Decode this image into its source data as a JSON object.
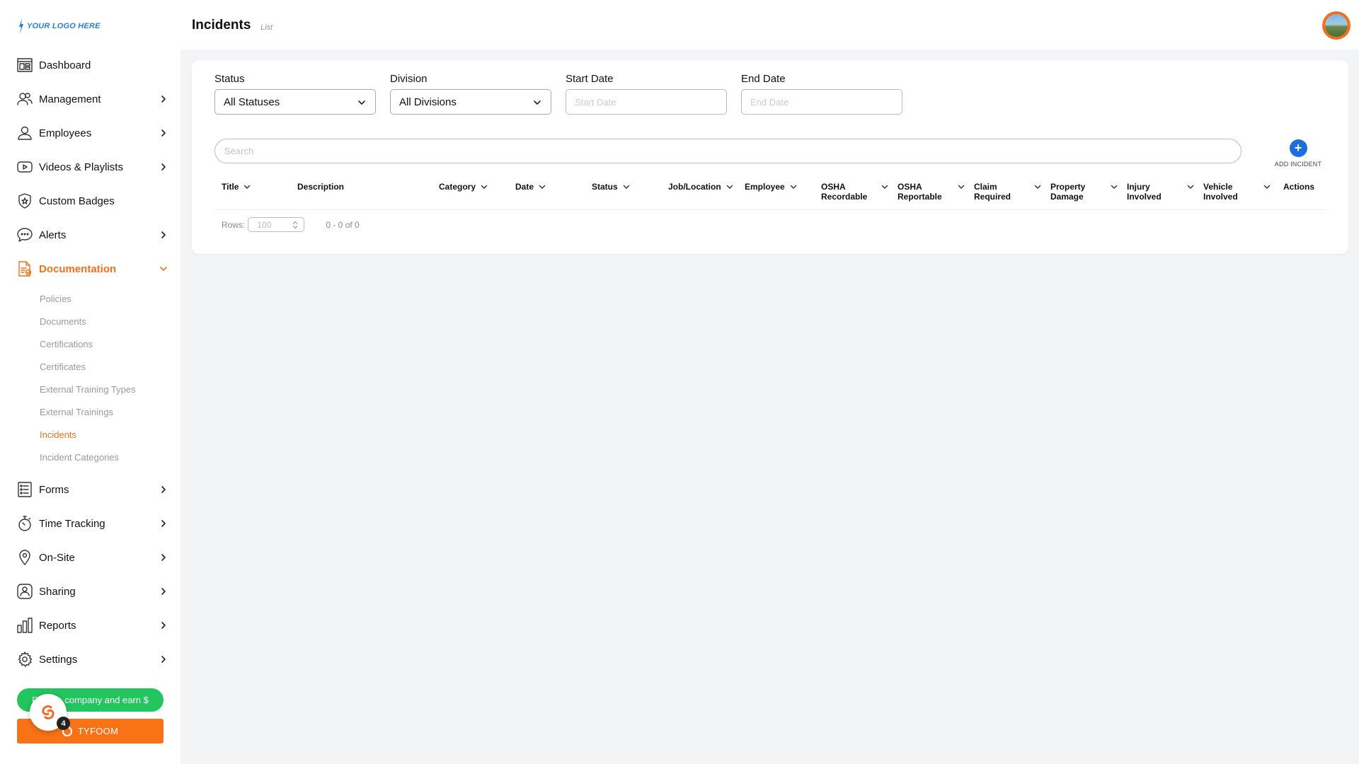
{
  "logo": {
    "text": "YOUR LOGO HERE"
  },
  "header": {
    "title": "Incidents",
    "subtitle": "List"
  },
  "sidebar": {
    "items": [
      {
        "id": "dashboard",
        "label": "Dashboard",
        "icon": "dashboard-icon",
        "chevron": false
      },
      {
        "id": "management",
        "label": "Management",
        "icon": "users-icon",
        "chevron": true
      },
      {
        "id": "employees",
        "label": "Employees",
        "icon": "user-icon",
        "chevron": true
      },
      {
        "id": "videos",
        "label": "Videos & Playlists",
        "icon": "play-icon",
        "chevron": true
      },
      {
        "id": "badges",
        "label": "Custom Badges",
        "icon": "badge-icon",
        "chevron": false
      },
      {
        "id": "alerts",
        "label": "Alerts",
        "icon": "chat-icon",
        "chevron": true
      },
      {
        "id": "documentation",
        "label": "Documentation",
        "icon": "document-icon",
        "chevron": true,
        "expanded": true
      },
      {
        "id": "forms",
        "label": "Forms",
        "icon": "form-icon",
        "chevron": true
      },
      {
        "id": "time-tracking",
        "label": "Time Tracking",
        "icon": "stopwatch-icon",
        "chevron": true
      },
      {
        "id": "on-site",
        "label": "On-Site",
        "icon": "location-icon",
        "chevron": true
      },
      {
        "id": "sharing",
        "label": "Sharing",
        "icon": "share-icon",
        "chevron": true
      },
      {
        "id": "reports",
        "label": "Reports",
        "icon": "bar-chart-icon",
        "chevron": true
      },
      {
        "id": "settings",
        "label": "Settings",
        "icon": "gear-icon",
        "chevron": true
      }
    ],
    "documentation_sub": [
      "Policies",
      "Documents",
      "Certifications",
      "Certificates",
      "External Training Types",
      "External Trainings",
      "Incidents",
      "Incident Categories"
    ],
    "active_sub": "Incidents",
    "refer_label": "Refer a company and earn $",
    "tyfoom_label": "TYFOOM",
    "notification_count": "4"
  },
  "filters": {
    "status": {
      "label": "Status",
      "value": "All Statuses"
    },
    "division": {
      "label": "Division",
      "value": "All Divisions"
    },
    "start_date": {
      "label": "Start Date",
      "placeholder": "Start Date"
    },
    "end_date": {
      "label": "End Date",
      "placeholder": "End Date"
    }
  },
  "search": {
    "placeholder": "Search"
  },
  "add_incident": {
    "label": "ADD INCIDENT"
  },
  "table": {
    "columns": [
      {
        "label": "Title",
        "sortable": true
      },
      {
        "label": "Description",
        "sortable": false
      },
      {
        "label": "Category",
        "sortable": true
      },
      {
        "label": "Date",
        "sortable": true
      },
      {
        "label": "Status",
        "sortable": true
      },
      {
        "label": "Job/Location",
        "sortable": true
      },
      {
        "label": "Employee",
        "sortable": true
      },
      {
        "label": "OSHA Recordable",
        "sortable": true
      },
      {
        "label": "OSHA Reportable",
        "sortable": true
      },
      {
        "label": "Claim Required",
        "sortable": true
      },
      {
        "label": "Property Damage",
        "sortable": true
      },
      {
        "label": "Injury Involved",
        "sortable": true
      },
      {
        "label": "Vehicle Involved",
        "sortable": true
      },
      {
        "label": "Actions",
        "sortable": false
      }
    ],
    "rows": []
  },
  "pagination": {
    "rows_label": "Rows:",
    "rows_value": "100",
    "range": "0 - 0 of 0"
  },
  "colors": {
    "accent": "#f07020",
    "primary": "#1d6fe0",
    "refer": "#22c55e",
    "tyfoom": "#f97316"
  }
}
